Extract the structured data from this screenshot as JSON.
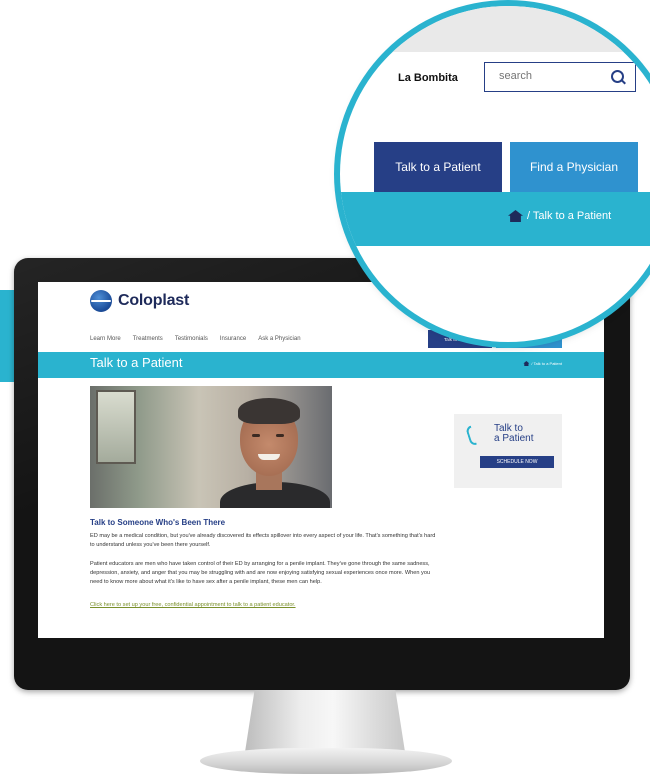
{
  "colors": {
    "accent_teal": "#2ab3cf",
    "navy": "#263f86",
    "blue": "#2f92cf",
    "link_green": "#7a8f2a"
  },
  "magnifier": {
    "brand": "La Bombita",
    "search_placeholder": "search",
    "search_icon": "search-icon",
    "buttons": {
      "talk": "Talk to a Patient",
      "find": "Find a Physician"
    },
    "breadcrumb": "/ Talk to a Patient",
    "home_icon": "home-icon"
  },
  "site": {
    "logo_text": "Coloplast",
    "nav": [
      "Learn More",
      "Treatments",
      "Testimonials",
      "Insurance",
      "Ask a Physician"
    ],
    "nav_buttons": {
      "talk": "Talk to a Patient",
      "find": "Find a Physician"
    },
    "page_title": "Talk to a Patient",
    "breadcrumb_small": "/ Talk to a Patient",
    "side_card": {
      "title_line1": "Talk to",
      "title_line2": "a Patient",
      "button": "SCHEDULE NOW"
    },
    "content": {
      "heading": "Talk to Someone Who's Been There",
      "para1": "ED may be a medical condition, but you've already discovered its effects spillover into every aspect of your life. That's something that's hard to understand unless you've been there yourself.",
      "para2": "Patient educators are men who have taken control of their ED by arranging for a penile implant. They've gone through the same sadness, depression, anxiety, and anger that you may be struggling with and are now enjoying satisfying sexual experiences once more. When you need to know more about what it's like to have sex after a penile implant, these men can help.",
      "cta": "Click here to set up your free, confidential appointment to talk to a patient educator."
    }
  }
}
